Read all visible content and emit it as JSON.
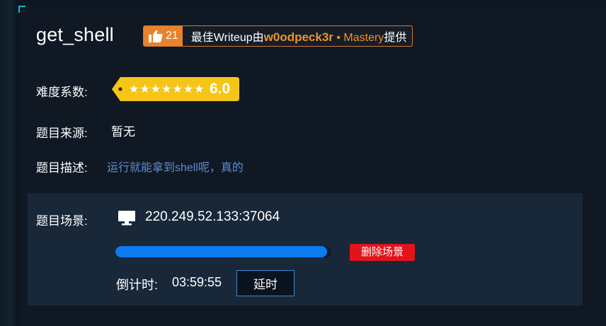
{
  "challenge": {
    "title": "get_shell"
  },
  "writeup_badge": {
    "likes": "21",
    "prefix": "最佳Writeup由",
    "author": "w0odpeck3r",
    "separator": " • ",
    "team": "Mastery",
    "suffix": "提供"
  },
  "difficulty": {
    "label": "难度系数:",
    "stars": "★★★★★★★",
    "star_count": 7,
    "value": "6.0",
    "tag_color": "#f5c518"
  },
  "source": {
    "label": "题目来源:",
    "value": "暂无"
  },
  "description": {
    "label": "题目描述:",
    "value": "运行就能拿到shell呢，真的"
  },
  "scene": {
    "label": "题目场景:",
    "address": "220.249.52.133:37064",
    "progress": 0.98,
    "delete_label": "删除场景",
    "countdown_label": "倒计时:",
    "countdown_value": "03:59:55",
    "extend_label": "延时"
  },
  "colors": {
    "accent_orange": "#e8822b",
    "progress_blue": "#0b7bf0",
    "delete_red": "#e2141a",
    "desc_blue": "#5b8fd0"
  }
}
